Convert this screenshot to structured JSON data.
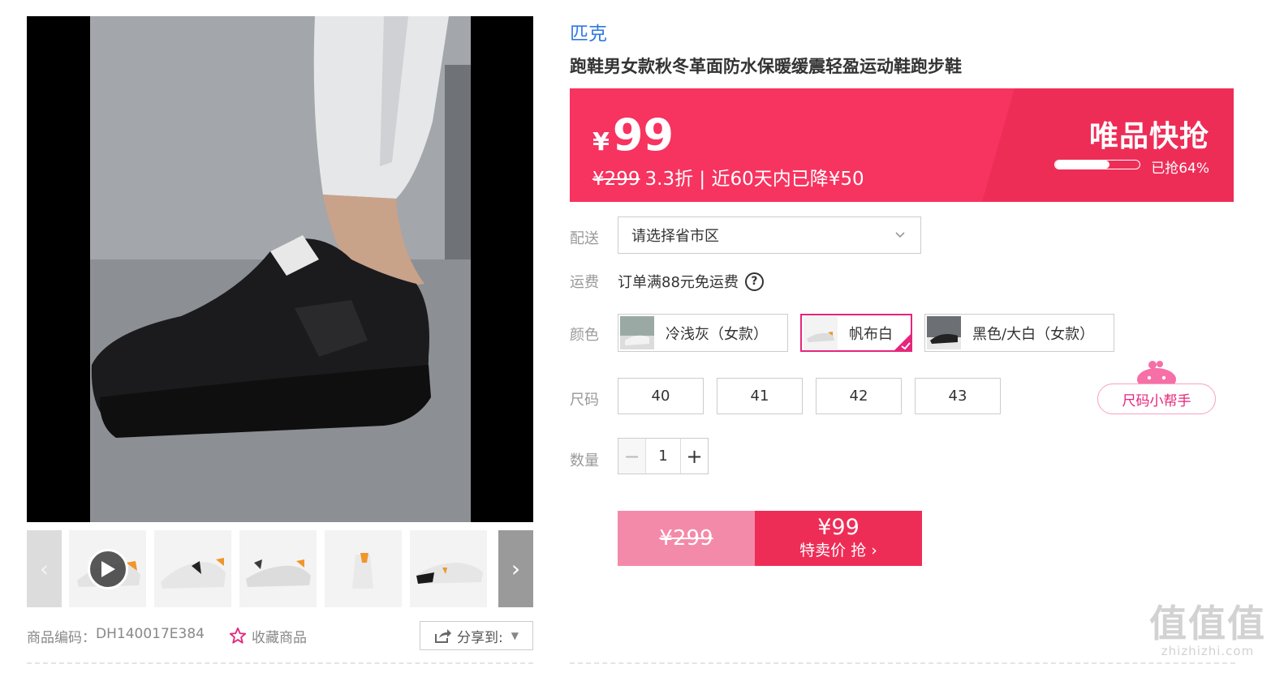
{
  "gallery": {
    "thumbnails": [
      "video",
      "side-white",
      "side-gray",
      "back-white",
      "top-white"
    ]
  },
  "item_meta": {
    "code_label": "商品编码：",
    "code_value": "DH140017E384",
    "favorite_label": "收藏商品",
    "share_label": "分享到:"
  },
  "product": {
    "brand": "匹克",
    "title": "跑鞋男女款秋冬革面防水保暖缓震轻盈运动鞋跑步鞋"
  },
  "price_panel": {
    "currency": "¥",
    "price": "99",
    "original_price": "¥299",
    "discount_info": "3.3折 | 近60天内已降¥50",
    "flash_title": "唯品快抢",
    "sold_percent": 64,
    "sold_text": "已抢64%"
  },
  "delivery": {
    "label": "配送",
    "placeholder": "请选择省市区"
  },
  "freight": {
    "label": "运费",
    "text": "订单满88元免运费"
  },
  "color": {
    "label": "颜色",
    "options": [
      {
        "label": "冷浅灰（女款）",
        "selected": false
      },
      {
        "label": "帆布白",
        "selected": true
      },
      {
        "label": "黑色/大白（女款）",
        "selected": false
      }
    ]
  },
  "size": {
    "label": "尺码",
    "options": [
      "40",
      "41",
      "42",
      "43"
    ],
    "helper": "尺码小帮手"
  },
  "quantity": {
    "label": "数量",
    "value": "1",
    "minus": "−",
    "plus": "+"
  },
  "buy": {
    "original_price": "¥299",
    "price": "¥99",
    "cta": "特卖价 抢 ›"
  },
  "watermark": {
    "big": "值值值",
    "small": "zhizhizhi.com"
  },
  "colors": {
    "accent": "#ee2d57",
    "panel": "#f7335f",
    "brand_link": "#2f7ae0",
    "selected_border": "#e6257b"
  }
}
